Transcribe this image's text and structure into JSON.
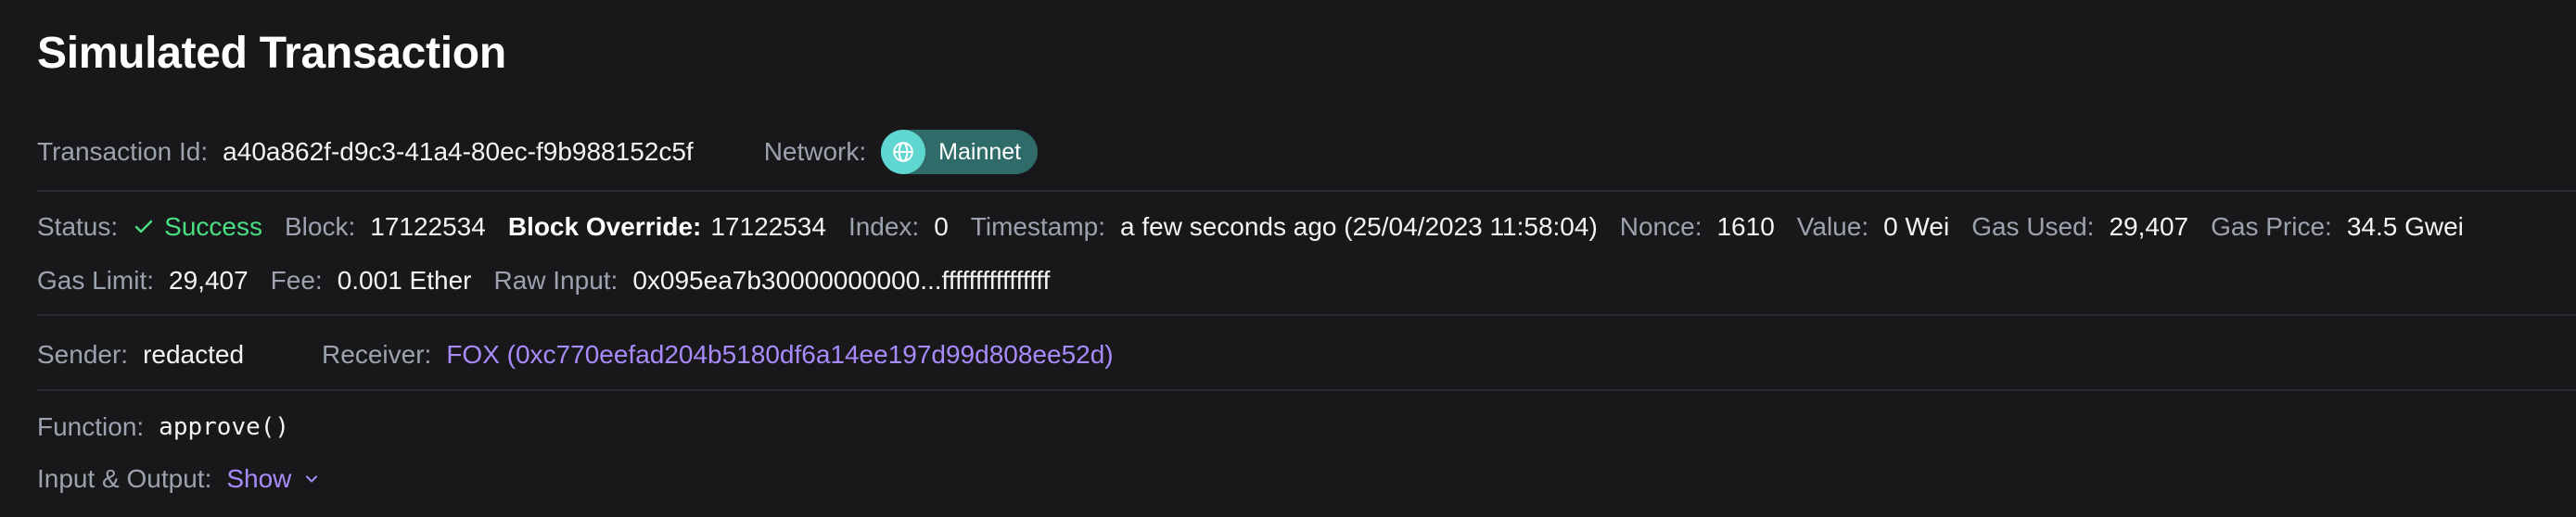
{
  "page_title": "Simulated Transaction",
  "transaction": {
    "label": "Transaction Id:",
    "value": "a40a862f-d9c3-41a4-80ec-f9b988152c5f"
  },
  "network": {
    "label": "Network:",
    "value": "Mainnet",
    "badge_color": "#2f6b68",
    "icon_color": "#5fd6cf"
  },
  "status": {
    "label": "Status:",
    "value": "Success",
    "icon": "check-icon",
    "color": "#4ade80"
  },
  "block": {
    "label": "Block:",
    "value": "17122534"
  },
  "block_override": {
    "label": "Block Override:",
    "value": "17122534"
  },
  "index": {
    "label": "Index:",
    "value": "0"
  },
  "timestamp": {
    "label": "Timestamp:",
    "value": "a few seconds ago (25/04/2023 11:58:04)"
  },
  "nonce": {
    "label": "Nonce:",
    "value": "1610"
  },
  "value": {
    "label": "Value:",
    "value": "0 Wei"
  },
  "gas_used": {
    "label": "Gas Used:",
    "value": "29,407"
  },
  "gas_price": {
    "label": "Gas Price:",
    "value": "34.5 Gwei"
  },
  "gas_limit": {
    "label": "Gas Limit:",
    "value": "29,407"
  },
  "fee": {
    "label": "Fee:",
    "value": "0.001 Ether"
  },
  "raw_input": {
    "label": "Raw Input:",
    "value": "0x095ea7b30000000000...ffffffffffffffff"
  },
  "sender": {
    "label": "Sender:",
    "value": "redacted"
  },
  "receiver": {
    "label": "Receiver:",
    "value": "FOX (0xc770eefad204b5180df6a14ee197d99d808ee52d)",
    "link_color": "#a78bfa"
  },
  "function": {
    "label": "Function:",
    "value": "approve()"
  },
  "io": {
    "label": "Input & Output:",
    "toggle": "Show",
    "icon": "chevron-down-icon"
  }
}
